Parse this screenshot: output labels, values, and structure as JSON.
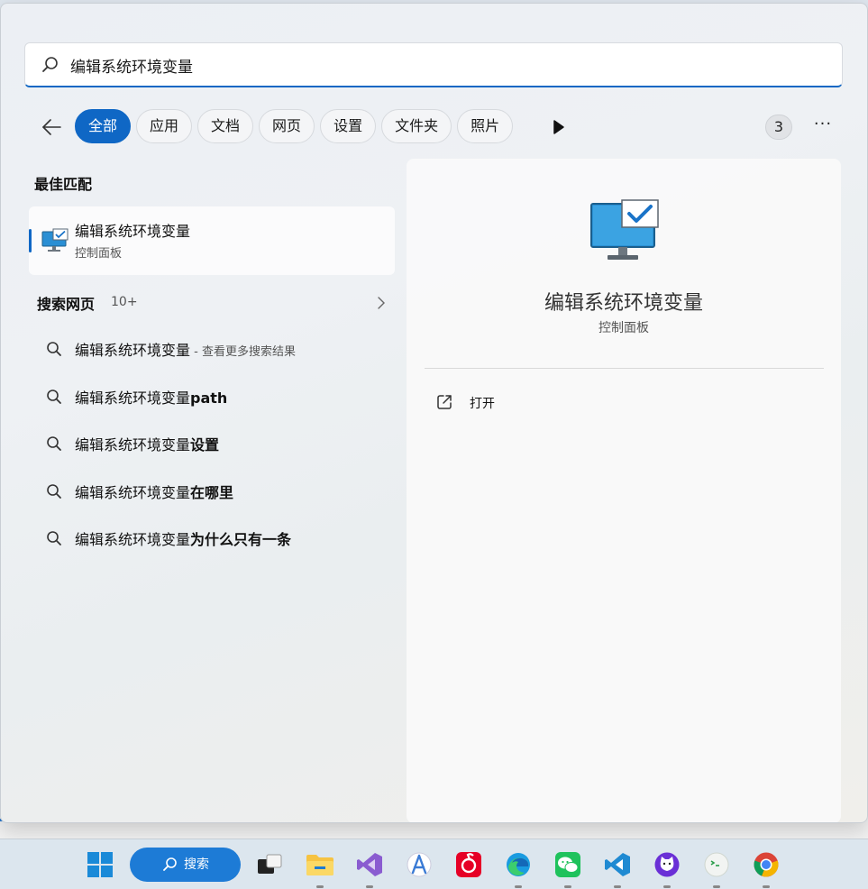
{
  "search": {
    "query": "编辑系统环境变量"
  },
  "filters": {
    "chips": [
      "全部",
      "应用",
      "文档",
      "网页",
      "设置",
      "文件夹",
      "照片"
    ],
    "active_index": 0,
    "count": "3",
    "more": "···"
  },
  "best_match": {
    "heading": "最佳匹配",
    "title": "编辑系统环境变量",
    "subtitle": "控制面板",
    "icon": "monitor-check-icon"
  },
  "web": {
    "heading": "搜索网页",
    "count": "10+",
    "suggestions": [
      {
        "base": "编辑系统环境变量",
        "bold": "",
        "hint": " - 查看更多搜索结果"
      },
      {
        "base": "编辑系统环境变量",
        "bold": "path",
        "hint": ""
      },
      {
        "base": "编辑系统环境变量",
        "bold": "设置",
        "hint": ""
      },
      {
        "base": "编辑系统环境变量",
        "bold": "在哪里",
        "hint": ""
      },
      {
        "base": "编辑系统环境变量",
        "bold": "为什么只有一条",
        "hint": ""
      }
    ]
  },
  "detail": {
    "title": "编辑系统环境变量",
    "subtitle": "控制面板",
    "action_label": "打开"
  },
  "taskbar": {
    "search_label": "搜索",
    "apps": [
      "windows-start-icon",
      "task-view-icon",
      "file-explorer-icon",
      "visual-studio-icon",
      "android-studio-icon",
      "netease-music-icon",
      "edge-icon",
      "wechat-icon",
      "vscode-icon",
      "cat-app-icon",
      "terminal-bot-icon",
      "chrome-icon"
    ]
  },
  "colors": {
    "accent": "#0f67c5",
    "taskbar_search": "#1d7bd6"
  }
}
